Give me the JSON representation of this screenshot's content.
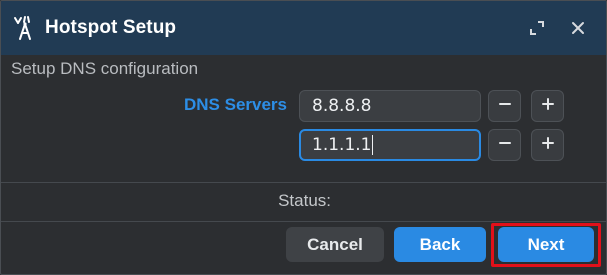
{
  "window": {
    "title": "Hotspot Setup"
  },
  "titlebar": {
    "app_icon": "wifi-tower-icon",
    "maximize_icon": "maximize-icon",
    "close_icon": "close-icon"
  },
  "page": {
    "subtitle": "Setup DNS configuration"
  },
  "dns": {
    "label": "DNS Servers",
    "servers": [
      {
        "value": "8.8.8.8",
        "focused": false
      },
      {
        "value": "1.1.1.1",
        "focused": true
      }
    ],
    "remove_icon": "minus-icon",
    "add_icon": "plus-icon"
  },
  "status": {
    "label": "Status:"
  },
  "buttons": {
    "cancel": "Cancel",
    "back": "Back",
    "next": "Next"
  },
  "colors": {
    "titlebar_bg": "#213b54",
    "accent": "#2a8ae3",
    "label_accent": "#2d8ee6",
    "highlight": "#e2101a",
    "window_bg": "#2c2e31"
  }
}
